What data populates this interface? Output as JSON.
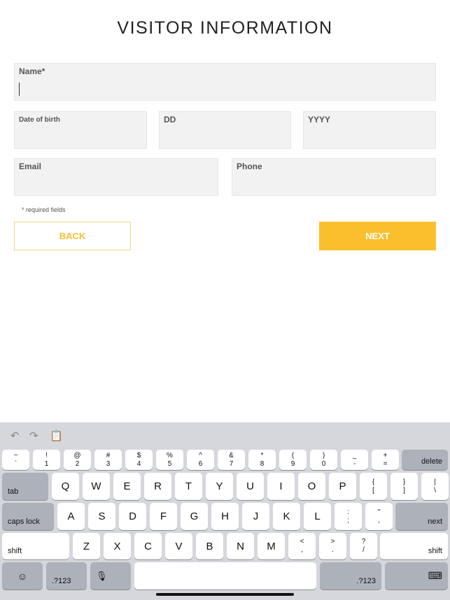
{
  "page_title": "VISITOR INFORMATION",
  "fields": {
    "name": "Name*",
    "dob": "Date of birth",
    "dd": "DD",
    "yyyy": "YYYY",
    "email": "Email",
    "phone": "Phone"
  },
  "required_note": "* required fields",
  "buttons": {
    "back": "BACK",
    "next": "NEXT"
  },
  "colors": {
    "accent": "#fbbf2e",
    "field_bg": "#f2f2f2",
    "keyboard_bg": "#d5d7dc"
  },
  "keyboard": {
    "toolbar": [
      "undo-icon",
      "redo-icon",
      "paste-icon"
    ],
    "row1": [
      [
        "~",
        "`"
      ],
      [
        "!",
        "1"
      ],
      [
        "@",
        "2"
      ],
      [
        "#",
        "3"
      ],
      [
        "$",
        "4"
      ],
      [
        "%",
        "5"
      ],
      [
        "^",
        "6"
      ],
      [
        "&",
        "7"
      ],
      [
        "*",
        "8"
      ],
      [
        "(",
        "9"
      ],
      [
        ")",
        "0"
      ],
      [
        "_",
        "-"
      ],
      [
        "+",
        "="
      ]
    ],
    "delete": "delete",
    "tab": "tab",
    "row2": [
      "Q",
      "W",
      "E",
      "R",
      "T",
      "Y",
      "U",
      "I",
      "O",
      "P",
      [
        "{",
        "["
      ],
      [
        "}",
        "]"
      ],
      [
        "|",
        "\\"
      ]
    ],
    "caps": "caps lock",
    "row3": [
      "A",
      "S",
      "D",
      "F",
      "G",
      "H",
      "J",
      "K",
      "L",
      [
        ":",
        ";"
      ],
      [
        "\"",
        ","
      ]
    ],
    "next": "next",
    "shift": "shift",
    "row4": [
      "Z",
      "X",
      "C",
      "V",
      "B",
      "N",
      "M",
      [
        "<",
        ","
      ],
      [
        ">",
        "."
      ],
      [
        "?",
        "/"
      ]
    ],
    "numbers": ".?123"
  }
}
